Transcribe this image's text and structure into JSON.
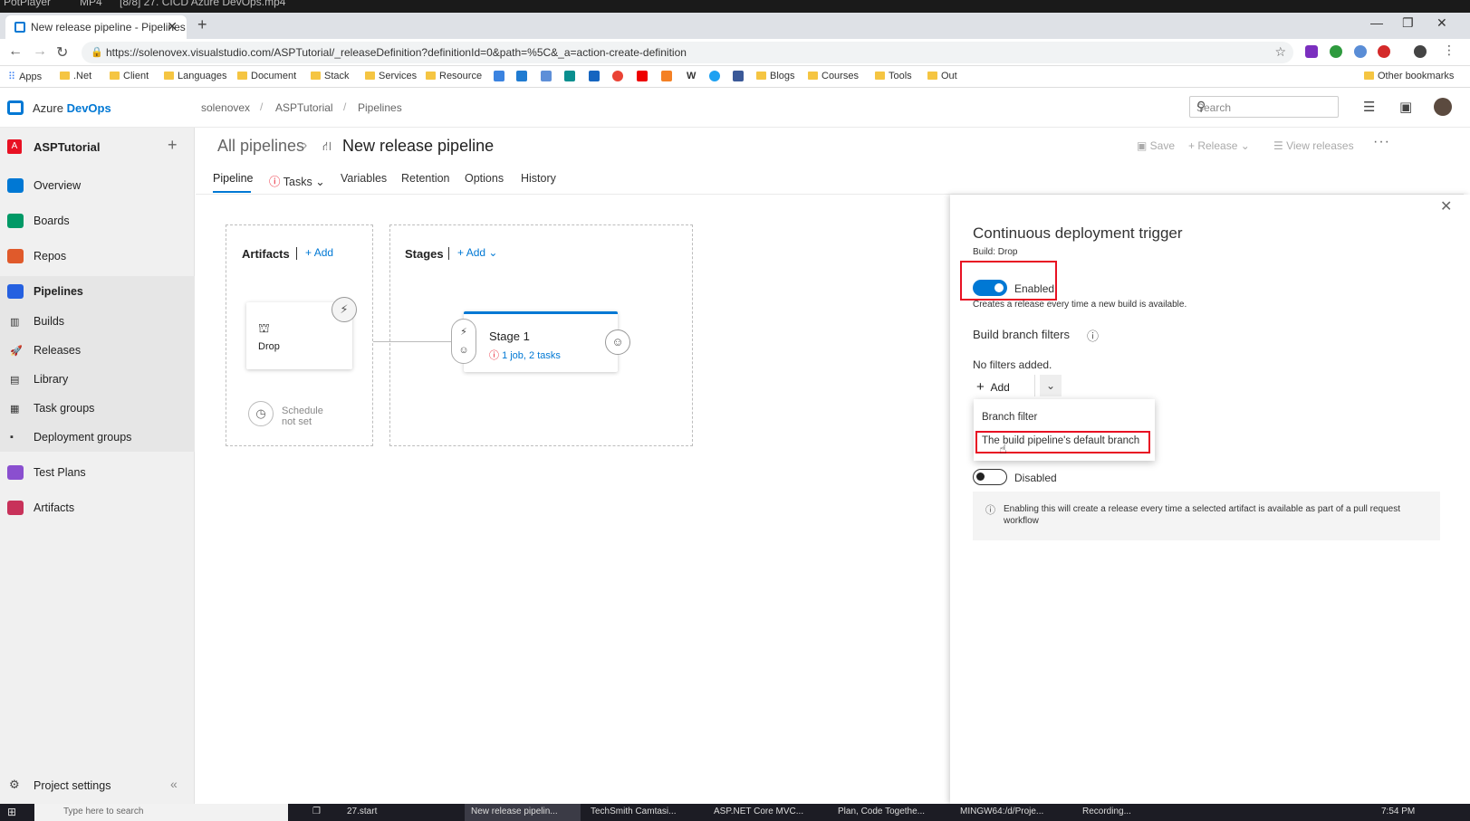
{
  "player": {
    "title_left": "PotPlayer",
    "format": "MP4",
    "file": "[8/8] 27. CICD Azure DevOps.mp4"
  },
  "browser": {
    "tab_title": "New release pipeline - Pipelines",
    "url": "https://solenovex.visualstudio.com/ASPTutorial/_releaseDefinition?definitionId=0&path=%5C&_a=action-create-definition",
    "bookmarks": [
      "Apps",
      ".Net",
      "Client",
      "Languages",
      "Document",
      "Stack",
      "Services",
      "Resource",
      "Blogs",
      "Courses",
      "Tools",
      "Out"
    ],
    "other_bookmarks": "Other bookmarks"
  },
  "header": {
    "brand_prefix": "Azure ",
    "brand_suffix": "DevOps",
    "breadcrumbs": [
      "solenovex",
      "ASPTutorial",
      "Pipelines"
    ],
    "search_placeholder": "Search"
  },
  "sidebar": {
    "project_initial": "A",
    "project_name": "ASPTutorial",
    "items": [
      "Overview",
      "Boards",
      "Repos",
      "Pipelines"
    ],
    "sub_items": [
      "Builds",
      "Releases",
      "Library",
      "Task groups",
      "Deployment groups"
    ],
    "bottom_items": [
      "Test Plans",
      "Artifacts"
    ],
    "settings": "Project settings"
  },
  "page": {
    "breadcrumb_root": "All pipelines",
    "title": "New release pipeline",
    "actions": {
      "save": "Save",
      "release": "Release",
      "view_releases": "View releases"
    },
    "tabs": [
      "Pipeline",
      "Tasks",
      "Variables",
      "Retention",
      "Options",
      "History"
    ]
  },
  "canvas": {
    "artifacts_title": "Artifacts",
    "stages_title": "Stages",
    "add_label": "Add",
    "artifact_name": "Drop",
    "schedule_line1": "Schedule",
    "schedule_line2": "not set",
    "stage_name": "Stage 1",
    "stage_detail": "1 job, 2 tasks"
  },
  "panel": {
    "title": "Continuous deployment trigger",
    "subtitle": "Build: Drop",
    "cd_toggle_label": "Enabled",
    "cd_toggle_on": true,
    "cd_description": "Creates a release every time a new build is available.",
    "filters_title": "Build branch filters",
    "no_filters": "No filters added.",
    "add_label": "Add",
    "dropdown_options": [
      "Branch filter",
      "The build pipeline's default branch"
    ],
    "pr_toggle_label": "Disabled",
    "pr_toggle_on": false,
    "pr_info_line1": "Enabling this will create a release every time a selected artifact is available as part of a pull request",
    "pr_info_line2": "workflow"
  },
  "taskbar": {
    "search_placeholder": "Type here to search",
    "items": [
      "27.start",
      "New release pipelin...",
      "TechSmith Camtasi...",
      "ASP.NET Core MVC...",
      "Plan, Code Togethe...",
      "MINGW64:/d/Proje...",
      "Recording..."
    ],
    "time": "7:54 PM"
  },
  "colors": {
    "accent": "#0078d4",
    "highlight": "#e81123",
    "sidebar_bg": "#f0f0f0"
  }
}
